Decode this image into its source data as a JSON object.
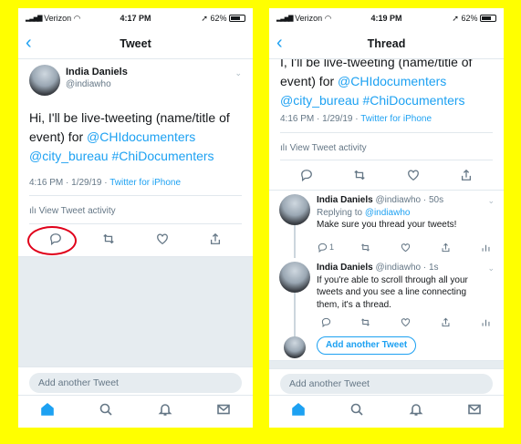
{
  "left": {
    "status": {
      "carrier": "Verizon",
      "time": "4:17 PM",
      "battery": "62%"
    },
    "nav": {
      "back": "‹",
      "title": "Tweet"
    },
    "tweet": {
      "name": "India Daniels",
      "handle": "@indiawho",
      "text_plain": "Hi, I'll be live-tweeting (name/title of event) for ",
      "mention1": "@CHIdocumenters",
      "mention2": "@city_bureau",
      "hashtag": "#ChiDocumenters",
      "timestamp": "4:16 PM · 1/29/19 · ",
      "source": "Twitter for iPhone",
      "activity": "View Tweet activity"
    },
    "compose_placeholder": "Add another Tweet"
  },
  "right": {
    "status": {
      "carrier": "Verizon",
      "time": "4:19 PM",
      "battery": "62%"
    },
    "nav": {
      "back": "‹",
      "title": "Thread"
    },
    "tweet": {
      "text_cut": "I, I'll be live-tweeting (name/title of",
      "text_line2_plain": "event) for ",
      "mention1": "@CHIdocumenters",
      "mention2": "@city_bureau",
      "hashtag": "#ChiDocumenters",
      "timestamp": "4:16 PM · 1/29/19 · ",
      "source": "Twitter for iPhone",
      "activity": "View Tweet activity"
    },
    "reply1": {
      "name": "India Daniels",
      "handle": "@indiawho",
      "time": "· 50s",
      "replying_label": "Replying to ",
      "replying_to": "@indiawho",
      "text": "Make sure you thread your tweets!",
      "reply_count": "1"
    },
    "reply2": {
      "name": "India Daniels",
      "handle": "@indiawho",
      "time": "· 1s",
      "text_line1": "If you're able to scroll through all your",
      "text_line2": "tweets and you see a line connecting",
      "text_line3": "them, it's a thread."
    },
    "add_button": "Add another Tweet",
    "compose_placeholder": "Add another Tweet"
  },
  "icons": {
    "reply": "reply-icon",
    "retweet": "retweet-icon",
    "like": "heart-icon",
    "share": "share-icon",
    "analytics": "analytics-icon",
    "home": "home-icon",
    "search": "search-icon",
    "notifications": "bell-icon",
    "messages": "mail-icon"
  },
  "colors": {
    "accent": "#1da1f2",
    "background": "#ffff00",
    "annotation": "#e0001a"
  }
}
